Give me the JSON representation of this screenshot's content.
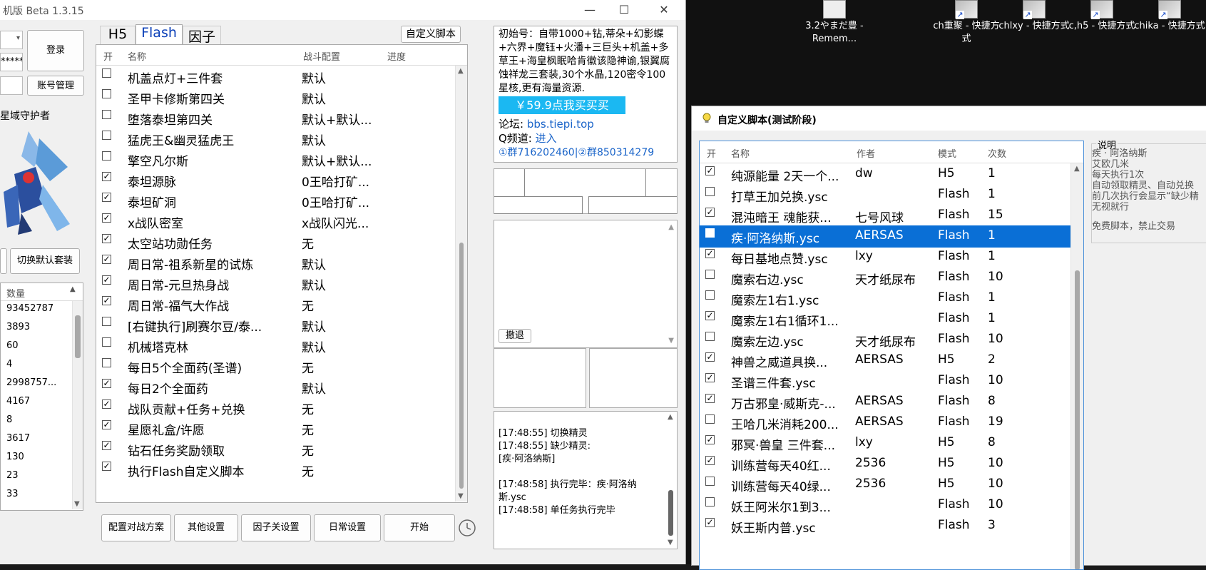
{
  "desktop": {
    "icons": [
      {
        "label": "3.2やまだ豊 - Remem...",
        "icon": "document-icon"
      },
      {
        "label": "ch重聚 - 快捷方式",
        "icon": "shortcut-icon"
      },
      {
        "label": "chlxy - 快捷方式",
        "icon": "shortcut-icon"
      },
      {
        "label": "c,h5 - 快捷方式",
        "icon": "shortcut-icon"
      },
      {
        "label": "chika - 快捷方式",
        "icon": "shortcut-icon"
      }
    ]
  },
  "main_window": {
    "title": "机版 Beta 1.3.15",
    "controls": {
      "minimize": "—",
      "maximize": "☐",
      "close": "✕"
    },
    "login": {
      "username_value": "",
      "password_value": "*****",
      "login_label": "登录",
      "account_mgmt_label": "账号管理",
      "third_field_value": ""
    },
    "character": {
      "name": "星域守护者",
      "switch_suit_label": "切换默认套装",
      "left_button_label": ""
    },
    "items": {
      "header": "数量",
      "values": [
        "93452787",
        "3893",
        "60",
        "4",
        "2998757...",
        "4167",
        "8",
        "3617",
        "130",
        "23",
        "33"
      ]
    },
    "tabs": [
      "H5",
      "Flash",
      "因子"
    ],
    "active_tab": "Flash",
    "custom_script_button": "自定义脚本",
    "task_headers": {
      "enabled": "开",
      "name": "名称",
      "config": "战斗配置",
      "progress": "进度"
    },
    "tasks": [
      {
        "checked": false,
        "name": "机盖点灯+三件套",
        "config": "默认"
      },
      {
        "checked": false,
        "name": "圣甲卡修斯第四关",
        "config": "默认"
      },
      {
        "checked": false,
        "name": "堕落泰坦第四关",
        "config": "默认+默认..."
      },
      {
        "checked": false,
        "name": "猛虎王&幽灵猛虎王",
        "config": "默认"
      },
      {
        "checked": false,
        "name": "擎空凡尔斯",
        "config": "默认+默认..."
      },
      {
        "checked": true,
        "name": "泰坦源脉",
        "config": "0王哈打矿..."
      },
      {
        "checked": true,
        "name": "泰坦矿洞",
        "config": "0王哈打矿..."
      },
      {
        "checked": true,
        "name": "x战队密室",
        "config": "x战队闪光..."
      },
      {
        "checked": true,
        "name": "太空站功勋任务",
        "config": "无"
      },
      {
        "checked": true,
        "name": "周日常-祖系新星的试炼",
        "config": "默认"
      },
      {
        "checked": true,
        "name": "周日常-元旦热身战",
        "config": "默认"
      },
      {
        "checked": true,
        "name": "周日常-福气大作战",
        "config": "无"
      },
      {
        "checked": false,
        "name": "[右键执行]刷赛尔豆/泰...",
        "config": "默认"
      },
      {
        "checked": false,
        "name": "机械塔克林",
        "config": "默认"
      },
      {
        "checked": false,
        "name": "每日5个全面药(圣谱)",
        "config": "无"
      },
      {
        "checked": true,
        "name": "每日2个全面药",
        "config": "默认"
      },
      {
        "checked": true,
        "name": "战队贡献+任务+兑换",
        "config": "无"
      },
      {
        "checked": true,
        "name": "星愿礼盒/许愿",
        "config": "无"
      },
      {
        "checked": true,
        "name": "钻石任务奖励领取",
        "config": "无"
      },
      {
        "checked": true,
        "name": "执行Flash自定义脚本",
        "config": "无"
      }
    ],
    "bottom_buttons": [
      "配置对战方案",
      "其他设置",
      "因子关设置",
      "日常设置",
      "开始"
    ],
    "clock_icon": "clock-icon",
    "ad": {
      "text": "初始号：自带1000+钻,蒂朵+幻影蝶+六界+魔钰+火潘+三巨头+机盖+多草王+海皇枫眠哈肯徽该隐神谕,银翼腐蚀祥龙三套装,30个水晶,120密令100星核,更有海量资源.",
      "buy_label": "￥59.9点我买买买",
      "forum_label": "论坛:",
      "forum_url": "bbs.tiepi.top",
      "qchannel_label": "Q频道:",
      "qchannel_link": "进入",
      "groups": "①群716202460|②群850314279"
    },
    "undo_label": "撤退",
    "log": [
      "[17:48:55] 切换精灵",
      "[17:48:55] 缺少精灵:",
      "[疾·阿洛纳斯]",
      "",
      "[17:48:58] 执行完毕：疾·阿洛纳",
      "斯.ysc",
      "[17:48:58] 单任务执行完毕"
    ]
  },
  "script_window": {
    "title": "自定义脚本(测试阶段)",
    "headers": {
      "enabled": "开",
      "name": "名称",
      "author": "作者",
      "mode": "模式",
      "count": "次数"
    },
    "selected_index": 3,
    "scripts": [
      {
        "checked": true,
        "name": "纯源能量 2天一个...",
        "author": "dw",
        "mode": "H5",
        "count": "1"
      },
      {
        "checked": false,
        "name": "打草王加兑换.ysc",
        "author": "",
        "mode": "Flash",
        "count": "1"
      },
      {
        "checked": true,
        "name": "混沌暗王 魂能获...",
        "author": "七号风球",
        "mode": "Flash",
        "count": "15"
      },
      {
        "checked": true,
        "name": "疾·阿洛纳斯.ysc",
        "author": "AERSAS",
        "mode": "Flash",
        "count": "1"
      },
      {
        "checked": true,
        "name": "每日基地点赞.ysc",
        "author": "lxy",
        "mode": "Flash",
        "count": "1"
      },
      {
        "checked": false,
        "name": "魔索右边.ysc",
        "author": "天才纸尿布",
        "mode": "Flash",
        "count": "10"
      },
      {
        "checked": false,
        "name": "魔索左1右1.ysc",
        "author": "",
        "mode": "Flash",
        "count": "1"
      },
      {
        "checked": true,
        "name": "魔索左1右1循环1...",
        "author": "",
        "mode": "Flash",
        "count": "1"
      },
      {
        "checked": false,
        "name": "魔索左边.ysc",
        "author": "天才纸尿布",
        "mode": "Flash",
        "count": "10"
      },
      {
        "checked": true,
        "name": "神兽之威道具换...",
        "author": "AERSAS",
        "mode": "H5",
        "count": "2"
      },
      {
        "checked": true,
        "name": "圣谱三件套.ysc",
        "author": "",
        "mode": "Flash",
        "count": "10"
      },
      {
        "checked": true,
        "name": "万古邪皇·威斯克-...",
        "author": "AERSAS",
        "mode": "Flash",
        "count": "8"
      },
      {
        "checked": false,
        "name": "王哈几米消耗200...",
        "author": "AERSAS",
        "mode": "Flash",
        "count": "19"
      },
      {
        "checked": true,
        "name": "邪冥·兽皇 三件套...",
        "author": "lxy",
        "mode": "H5",
        "count": "8"
      },
      {
        "checked": true,
        "name": "训练营每天40红...",
        "author": "2536",
        "mode": "H5",
        "count": "10"
      },
      {
        "checked": false,
        "name": "训练营每天40绿...",
        "author": "2536",
        "mode": "H5",
        "count": "10"
      },
      {
        "checked": false,
        "name": "妖王阿米尔1到3...",
        "author": "",
        "mode": "Flash",
        "count": "10"
      },
      {
        "checked": true,
        "name": "妖王斯内普.ysc",
        "author": "",
        "mode": "Flash",
        "count": "3"
      }
    ],
    "desc_group": "说明",
    "desc_lines": [
      "疾 · 阿洛纳斯",
      "艾欧几米",
      "每天执行1次",
      "自动领取精灵、自动兑换"
    ],
    "desc_extra": [
      "前几次执行会显示“缺少精",
      "无视就行"
    ],
    "notice": "免费脚本，禁止交易"
  }
}
